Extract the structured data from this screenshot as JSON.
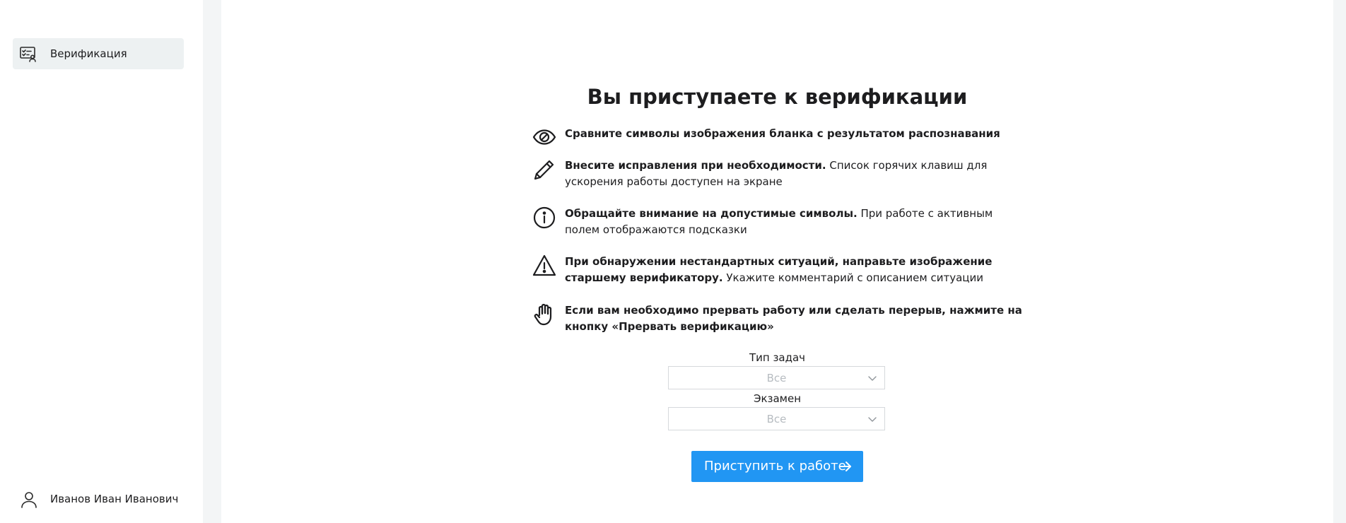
{
  "sidebar": {
    "nav_item_label": "Верификация",
    "nav_item_icon": "verification-card-icon",
    "user_name": "Иванов Иван Иванович",
    "user_icon": "user-icon"
  },
  "main": {
    "title": "Вы приступаете к верификации",
    "rules": [
      {
        "icon": "eye-icon",
        "bold": "Сравните символы изображения бланка с результатом распознавания",
        "text": ""
      },
      {
        "icon": "pencil-icon",
        "bold": "Внесите исправления при необходимости.",
        "text": " Список горячих клавиш для ускорения работы доступен на экране"
      },
      {
        "icon": "info-icon",
        "bold": "Обращайте внимание на допустимые символы.",
        "text": " При работе с активным полем отображаются подсказки"
      },
      {
        "icon": "warning-icon",
        "bold": "При обнаружении нестандартных ситуаций, направьте изображение старшему верификатору.",
        "text": " Укажите комментарий с описанием ситуации"
      },
      {
        "icon": "hand-stop-icon",
        "bold": "Если вам необходимо прервать работу или сделать перерыв, нажмите на кнопку «Прервать верификацию»",
        "text": ""
      }
    ],
    "task_type": {
      "label": "Тип задач",
      "value": "Все"
    },
    "exam": {
      "label": "Экзамен",
      "value": "Все"
    },
    "start_button": "Приступить к работе"
  },
  "colors": {
    "accent": "#2196f3",
    "sidebar_active_bg": "#edf1f2",
    "gutter": "#f3f5f6",
    "placeholder_text": "#b7bcc1"
  }
}
